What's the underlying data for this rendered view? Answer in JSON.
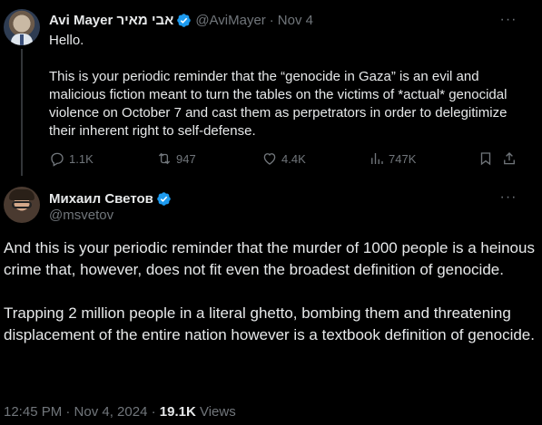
{
  "parent_tweet": {
    "author_name": "Avi Mayer אבי מאיר",
    "handle": "@AviMayer",
    "separator": "·",
    "date": "Nov 4",
    "more_label": "···",
    "greeting": "Hello.",
    "body": "This is your periodic reminder that the “genocide in Gaza” is an evil and malicious fiction meant to turn the tables on the victims of *actual* genocidal violence on October 7 and cast them as perpetrators in order to delegitimize their inherent right to self-defense.",
    "stats": {
      "replies": "1.1K",
      "reposts": "947",
      "likes": "4.4K",
      "views": "747K"
    }
  },
  "main_tweet": {
    "author_name": "Михаил Светов",
    "handle": "@msvetov",
    "more_label": "···",
    "paragraph_1": "And this is your periodic reminder that the murder of 1000 people is a heinous crime that, however, does not fit even the broadest definition of genocide.",
    "paragraph_2": "Trapping 2 million people in a literal ghetto, bombing them and threatening displacement of the entire nation however is a textbook definition of genocide.",
    "timestamp": "12:45 PM · Nov 4, 2024 ·",
    "view_count": "19.1K",
    "views_label": "Views"
  },
  "colors": {
    "background": "#000000",
    "text_primary": "#e7e9ea",
    "text_secondary": "#71767b",
    "verified_blue": "#1d9bf0",
    "divider": "#333639"
  },
  "icons": [
    "verified-badge-icon",
    "more-icon",
    "reply-icon",
    "repost-icon",
    "like-icon",
    "views-icon",
    "bookmark-icon",
    "share-icon"
  ]
}
